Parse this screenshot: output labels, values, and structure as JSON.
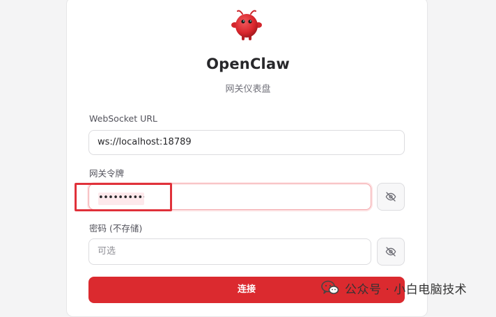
{
  "header": {
    "app_name": "OpenClaw",
    "subtitle": "网关仪表盘"
  },
  "form": {
    "websocket": {
      "label": "WebSocket URL",
      "value": "ws://localhost:18789"
    },
    "token": {
      "label": "网关令牌",
      "masked_value": "••••••••••••"
    },
    "password": {
      "label": "密码 (不存储)",
      "placeholder": "可选"
    },
    "connect_label": "连接"
  },
  "watermark": {
    "text": "公众号 · 小白电脑技术"
  },
  "colors": {
    "accent": "#db2a2f",
    "highlight_box": "#e0313a",
    "logo": "#e3343a"
  },
  "icons": {
    "logo": "red-crab-mascot-icon",
    "toggle_visibility": "eye-off-icon",
    "watermark": "wechat-icon"
  }
}
